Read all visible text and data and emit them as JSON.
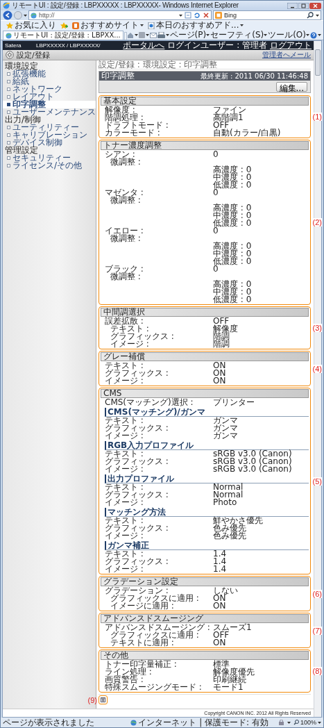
{
  "window": {
    "title": "リモートUI : 設定/登録 : LBPXXXXX : LBPXXXXX- Windows Internet Explorer"
  },
  "address_bar": {
    "value": "http://"
  },
  "search_box": {
    "value": "Bing"
  },
  "favorites_bar": {
    "favorites": "お気に入り",
    "items": [
      "おすすめサイト",
      "本日のおすすめアド..."
    ]
  },
  "tab": {
    "title": "リモートUI : 設定/登録 : LBPXX..."
  },
  "command_bar": [
    "ページ(P)",
    "セーフティ(S)",
    "ツール(O)"
  ],
  "header": {
    "brand": "Satera",
    "model": "LBPXXXXX / LBPXXXXX/",
    "portal_link": "ポータルへ",
    "login_user": "ログインユーザー : 管理者",
    "logout_link": "ログアウト"
  },
  "page_title": {
    "title": "設定/登録",
    "mail_link": "管理者へメール"
  },
  "sidebar": [
    {
      "group": "環境設定",
      "items": [
        {
          "label": "拡張機能",
          "selected": false
        },
        {
          "label": "給紙",
          "selected": false
        },
        {
          "label": "ネットワーク",
          "selected": false
        },
        {
          "label": "レイアウト",
          "selected": false
        },
        {
          "label": "印字調整",
          "selected": true
        },
        {
          "label": "ユーザーメンテナンス",
          "selected": false
        }
      ]
    },
    {
      "group": "出力/制御",
      "items": [
        {
          "label": "ユーティリティー",
          "selected": false
        },
        {
          "label": "キャリブレーション",
          "selected": false
        },
        {
          "label": "デバイス制御",
          "selected": false
        }
      ]
    },
    {
      "group": "管理設定",
      "items": [
        {
          "label": "セキュリティー",
          "selected": false
        },
        {
          "label": "ライセンス/その他",
          "selected": false
        }
      ]
    }
  ],
  "breadcrumb": "設定/登録 : 環境設定 : 印字調整",
  "panel": {
    "title": "印字調整",
    "last_updated": "最終更新 : 2011 06/30 11:46:48",
    "edit_button": "編集..."
  },
  "sections": [
    {
      "title": "基本設定",
      "callout": "(1)",
      "rows": [
        {
          "kind": "row",
          "label": "解像度 :",
          "value": "ファイン"
        },
        {
          "kind": "row",
          "label": "階調処理 :",
          "value": "高階調1"
        },
        {
          "kind": "row",
          "label": "ドラフトモード :",
          "value": "OFF"
        },
        {
          "kind": "row",
          "label": "カラーモード :",
          "value": "自動(カラー/白黒)"
        }
      ]
    },
    {
      "title": "トナー濃度調整",
      "callout": "(2)",
      "rows": [
        {
          "kind": "row",
          "label": "シアン :",
          "value": "0"
        },
        {
          "kind": "sub",
          "label": "微調整 :"
        },
        {
          "kind": "detail",
          "value": "高濃度 : 0"
        },
        {
          "kind": "detail",
          "value": "中濃度 : 0"
        },
        {
          "kind": "detail",
          "value": "低濃度 : 0"
        },
        {
          "kind": "row",
          "label": "マゼンタ :",
          "value": "0"
        },
        {
          "kind": "sub",
          "label": "微調整 :"
        },
        {
          "kind": "detail",
          "value": "高濃度 : 0"
        },
        {
          "kind": "detail",
          "value": "中濃度 : 0"
        },
        {
          "kind": "detail",
          "value": "低濃度 : 0"
        },
        {
          "kind": "row",
          "label": "イエロー :",
          "value": "0"
        },
        {
          "kind": "sub",
          "label": "微調整 :"
        },
        {
          "kind": "detail",
          "value": "高濃度 : 0"
        },
        {
          "kind": "detail",
          "value": "中濃度 : 0"
        },
        {
          "kind": "detail",
          "value": "低濃度 : 0"
        },
        {
          "kind": "row",
          "label": "ブラック :",
          "value": "0"
        },
        {
          "kind": "sub",
          "label": "微調整 :"
        },
        {
          "kind": "detail",
          "value": "高濃度 : 0"
        },
        {
          "kind": "detail",
          "value": "中濃度 : 0"
        },
        {
          "kind": "detail",
          "value": "低濃度 : 0"
        }
      ]
    },
    {
      "title": "中間調選択",
      "callout": "(3)",
      "rows": [
        {
          "kind": "row",
          "label": "誤差拡散 :",
          "value": "OFF"
        },
        {
          "kind": "sub",
          "label": "テキスト :",
          "value": "解像度"
        },
        {
          "kind": "sub",
          "label": "グラフィックス :",
          "value": "階調"
        },
        {
          "kind": "sub",
          "label": "イメージ :",
          "value": "階調"
        }
      ]
    },
    {
      "title": "グレー補償",
      "callout": "(4)",
      "rows": [
        {
          "kind": "row",
          "label": "テキスト :",
          "value": "ON"
        },
        {
          "kind": "row",
          "label": "グラフィックス :",
          "value": "ON"
        },
        {
          "kind": "row",
          "label": "イメージ :",
          "value": "ON"
        }
      ]
    },
    {
      "title": "CMS",
      "callout": "(5)",
      "rows": [
        {
          "kind": "row",
          "label": "CMS(マッチング)選択 :",
          "value": "プリンター"
        },
        {
          "kind": "heading",
          "label": "CMS(マッチング)/ガンマ"
        },
        {
          "kind": "row",
          "label": "テキスト :",
          "value": "ガンマ"
        },
        {
          "kind": "row",
          "label": "グラフィックス :",
          "value": "ガンマ"
        },
        {
          "kind": "row",
          "label": "イメージ :",
          "value": "ガンマ"
        },
        {
          "kind": "heading",
          "label": "RGB入力プロファイル"
        },
        {
          "kind": "row",
          "label": "テキスト :",
          "value": "sRGB v3.0 (Canon)"
        },
        {
          "kind": "row",
          "label": "グラフィックス :",
          "value": "sRGB v3.0 (Canon)"
        },
        {
          "kind": "row",
          "label": "イメージ :",
          "value": "sRGB v3.0 (Canon)"
        },
        {
          "kind": "heading",
          "label": "出力プロファイル"
        },
        {
          "kind": "row",
          "label": "テキスト :",
          "value": "Normal"
        },
        {
          "kind": "row",
          "label": "グラフィックス :",
          "value": "Normal"
        },
        {
          "kind": "row",
          "label": "イメージ :",
          "value": "Photo"
        },
        {
          "kind": "heading",
          "label": "マッチング方法"
        },
        {
          "kind": "row",
          "label": "テキスト :",
          "value": "鮮やかさ優先"
        },
        {
          "kind": "row",
          "label": "グラフィックス :",
          "value": "色み優先"
        },
        {
          "kind": "row",
          "label": "イメージ :",
          "value": "色み優先"
        },
        {
          "kind": "heading",
          "label": "ガンマ補正"
        },
        {
          "kind": "row",
          "label": "テキスト :",
          "value": "1.4"
        },
        {
          "kind": "row",
          "label": "グラフィックス :",
          "value": "1.4"
        },
        {
          "kind": "row",
          "label": "イメージ :",
          "value": "1.4"
        }
      ]
    },
    {
      "title": "グラデーション設定",
      "callout": "(6)",
      "rows": [
        {
          "kind": "row",
          "label": "グラデーション :",
          "value": "しない"
        },
        {
          "kind": "sub",
          "label": "グラフィックスに適用 :",
          "value": "ON"
        },
        {
          "kind": "sub",
          "label": "イメージに適用 :",
          "value": "ON"
        }
      ]
    },
    {
      "title": "アドバンスドスムージング",
      "callout": "(7)",
      "rows": [
        {
          "kind": "row",
          "label": "アドバンスドスムージング :",
          "value": "スムーズ1"
        },
        {
          "kind": "sub",
          "label": "グラフィックスに適用 :",
          "value": "OFF"
        },
        {
          "kind": "sub",
          "label": "テキストに適用 :",
          "value": "ON"
        }
      ]
    },
    {
      "title": "その他",
      "callout": "(8)",
      "rows": [
        {
          "kind": "row",
          "label": "トナー印字量補正 :",
          "value": "標準"
        },
        {
          "kind": "row",
          "label": "ライン処理 :",
          "value": "解像度優先"
        },
        {
          "kind": "row",
          "label": "画質警告 :",
          "value": "印刷継続"
        },
        {
          "kind": "row",
          "label": "特殊スムージングモード :",
          "value": "モード1"
        }
      ]
    }
  ],
  "top_button": {
    "callout": "(9)"
  },
  "copyright": "Copyright CANON INC. 2012 All Rights Reserved",
  "status_bar": {
    "message": "ページが表示されました",
    "zone": "インターネット | 保護モード: 有効",
    "zoom": "100%"
  }
}
